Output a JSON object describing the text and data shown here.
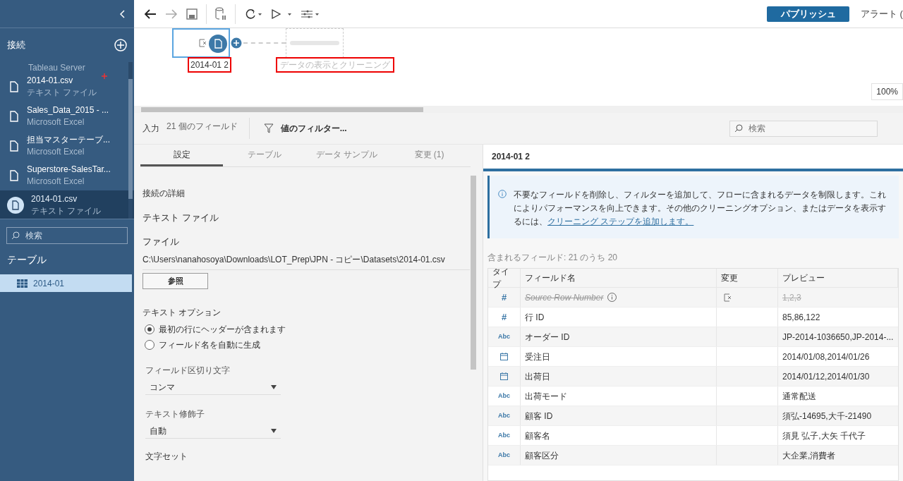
{
  "toolbar": {
    "publish": "パブリッシュ",
    "alerts": "アラート ("
  },
  "sidebar": {
    "connections_title": "接続",
    "connections": [
      {
        "type": "Tableau Server",
        "selected": false,
        "new": false
      },
      {
        "name": "2014-01.csv",
        "type": "テキスト ファイル",
        "selected": false,
        "new": true
      },
      {
        "name": "Sales_Data_2015 - ...",
        "type": "Microsoft Excel",
        "selected": false,
        "new": false
      },
      {
        "name": "担当マスターテーブ...",
        "type": "Microsoft Excel",
        "selected": false,
        "new": false
      },
      {
        "name": "Superstore-SalesTar...",
        "type": "Microsoft Excel",
        "selected": false,
        "new": false
      },
      {
        "name": "2014-01.csv",
        "type": "テキスト ファイル",
        "selected": true,
        "new": false
      }
    ],
    "search_placeholder": "検索",
    "tables_title": "テーブル",
    "tables": [
      {
        "name": "2014-01",
        "selected": true
      }
    ]
  },
  "flow": {
    "input_node": "2014-01 2",
    "clean_node": "データの表示とクリーニング",
    "zoom": "100%"
  },
  "input_bar": {
    "label": "入力",
    "fields": "21 個のフィールド",
    "filter": "値のフィルター...",
    "search_placeholder": "検索"
  },
  "settings": {
    "tabs": [
      {
        "label": "設定",
        "selected": true
      },
      {
        "label": "テーブル",
        "selected": false
      },
      {
        "label": "データ サンプル",
        "selected": false
      },
      {
        "label": "変更 (1)",
        "selected": false
      }
    ],
    "section": "接続の詳細",
    "conn_type": "テキスト ファイル",
    "file_label": "ファイル",
    "file_path": "C:\\Users\\nanahosoya\\Downloads\\LOT_Prep\\JPN - コピー\\Datasets\\2014-01.csv",
    "browse": "参照",
    "text_options": "テキスト オプション",
    "radios": [
      {
        "label": "最初の行にヘッダーが含まれます",
        "selected": true
      },
      {
        "label": "フィールド名を自動に生成",
        "selected": false
      }
    ],
    "dropdowns": [
      {
        "label": "フィールド区切り文字",
        "value": "コンマ"
      },
      {
        "label": "テキスト修飾子",
        "value": "自動"
      }
    ],
    "charset_label": "文字セット"
  },
  "details": {
    "title": "2014-01 2",
    "info": "不要なフィールドを削除し、フィルターを追加して、フローに含まれるデータを制限します。これによりパフォーマンスを向上できます。その他のクリーニングオプション、またはデータを表示するには、",
    "info_link": "クリーニング ステップを追加します。",
    "count": "含まれるフィールド: 21 のうち 20",
    "columns": [
      "タイプ",
      "フィールド名",
      "変更",
      "プレビュー"
    ],
    "rows": [
      {
        "kind": "number",
        "type_label": "#",
        "name": "Source Row Number",
        "removed": true,
        "preview": "1,2,3"
      },
      {
        "kind": "number",
        "type_label": "#",
        "name": "行 ID",
        "removed": false,
        "preview": "85,86,122"
      },
      {
        "kind": "string",
        "type_label": "Abc",
        "name": "オーダー ID",
        "removed": false,
        "preview": "JP-2014-1036650,JP-2014-..."
      },
      {
        "kind": "date",
        "name": "受注日",
        "removed": false,
        "preview": "2014/01/08,2014/01/26"
      },
      {
        "kind": "date",
        "name": "出荷日",
        "removed": false,
        "preview": "2014/01/12,2014/01/30"
      },
      {
        "kind": "string",
        "type_label": "Abc",
        "name": "出荷モード",
        "removed": false,
        "preview": "通常配送"
      },
      {
        "kind": "string",
        "type_label": "Abc",
        "name": "顧客 ID",
        "removed": false,
        "preview": "須弘-14695,大千-21490"
      },
      {
        "kind": "string",
        "type_label": "Abc",
        "name": "顧客名",
        "removed": false,
        "preview": "須見 弘子,大矢 千代子"
      },
      {
        "kind": "string",
        "type_label": "Abc",
        "name": "顧客区分",
        "removed": false,
        "preview": "大企業,消費者"
      }
    ]
  }
}
